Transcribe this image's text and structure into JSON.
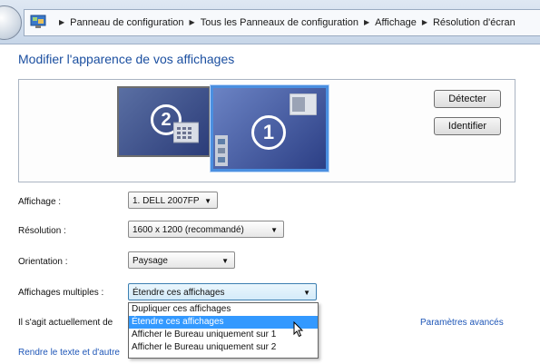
{
  "breadcrumb": [
    "Panneau de configuration",
    "Tous les Panneaux de configuration",
    "Affichage",
    "Résolution d'écran"
  ],
  "page_title": "Modifier l'apparence de vos affichages",
  "monitors": {
    "secondary_number": "2",
    "primary_number": "1"
  },
  "buttons": {
    "detect": "Détecter",
    "identify": "Identifier"
  },
  "fields": {
    "display": {
      "label": "Affichage :",
      "value": "1. DELL 2007FP"
    },
    "resolution": {
      "label": "Résolution :",
      "value": "1600 x 1200 (recommandé)"
    },
    "orientation": {
      "label": "Orientation :",
      "value": "Paysage"
    },
    "multiple": {
      "label": "Affichages multiples :",
      "value": "Étendre ces affichages"
    }
  },
  "dropdown_options": [
    "Dupliquer ces affichages",
    "Étendre ces affichages",
    "Afficher le Bureau uniquement sur 1",
    "Afficher le Bureau uniquement sur 2"
  ],
  "info_text": "Il s'agit actuellement de",
  "advanced_link": "Paramètres avancés",
  "footer_link": "Rendre le texte et d'autre",
  "colors": {
    "accent": "#3399ff",
    "title": "#1b4fa0",
    "link": "#1e56b7"
  }
}
